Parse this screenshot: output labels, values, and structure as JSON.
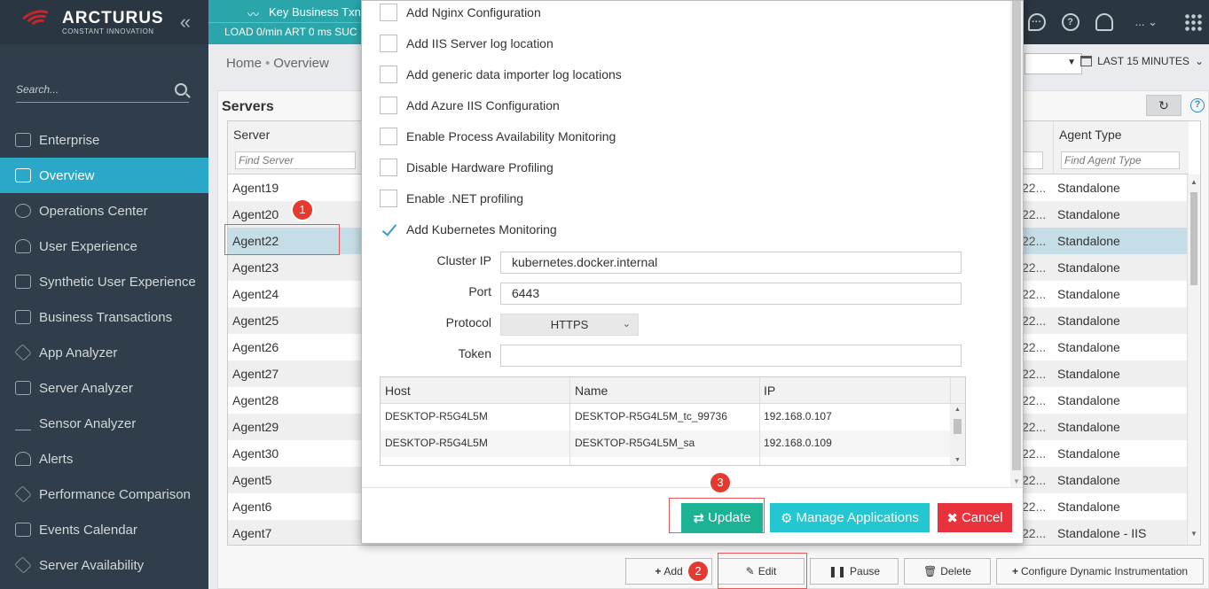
{
  "brand": {
    "name": "ARCTURUS",
    "tagline": "CONSTANT INNOVATION"
  },
  "sidebar": {
    "search_placeholder": "Search...",
    "items": [
      {
        "label": "Enterprise",
        "icon": "house-icon"
      },
      {
        "label": "Overview",
        "icon": "overview-icon",
        "active": true
      },
      {
        "label": "Operations Center",
        "icon": "globe-icon"
      },
      {
        "label": "User Experience",
        "icon": "user-icon"
      },
      {
        "label": "Synthetic User Experience",
        "icon": "map-icon"
      },
      {
        "label": "Business Transactions",
        "icon": "folder-icon"
      },
      {
        "label": "App Analyzer",
        "icon": "layers-icon"
      },
      {
        "label": "Server Analyzer",
        "icon": "bar-chart-icon"
      },
      {
        "label": "Sensor Analyzer",
        "icon": "line-chart-icon"
      },
      {
        "label": "Alerts",
        "icon": "bell-icon"
      },
      {
        "label": "Performance Comparison",
        "icon": "rocket-icon"
      },
      {
        "label": "Events Calendar",
        "icon": "calendar-icon"
      },
      {
        "label": "Server Availability",
        "icon": "tag-icon"
      }
    ]
  },
  "topbar": {
    "ktx_title": "Key Business Txn",
    "ktx_metrics": "LOAD 0/min  ART 0 ms  SUC",
    "more": "...",
    "accent": "#2aa5a9"
  },
  "breadcrumb": {
    "home": "Home",
    "current": "Overview"
  },
  "timerange": "LAST 15 MINUTES",
  "servers": {
    "title": "Servers",
    "col_server": "Server",
    "col_agent_type": "Agent Type",
    "filter_server": "Find Server",
    "filter_agent_type": "Find Agent Type",
    "rows": [
      {
        "name": "Agent19",
        "mid": "22...",
        "type": "Standalone"
      },
      {
        "name": "Agent20",
        "mid": "22...",
        "type": "Standalone"
      },
      {
        "name": "Agent22",
        "mid": "22...",
        "type": "Standalone",
        "selected": true
      },
      {
        "name": "Agent23",
        "mid": "22...",
        "type": "Standalone"
      },
      {
        "name": "Agent24",
        "mid": "22...",
        "type": "Standalone"
      },
      {
        "name": "Agent25",
        "mid": "22...",
        "type": "Standalone"
      },
      {
        "name": "Agent26",
        "mid": "22...",
        "type": "Standalone"
      },
      {
        "name": "Agent27",
        "mid": "22...",
        "type": "Standalone"
      },
      {
        "name": "Agent28",
        "mid": "22...",
        "type": "Standalone"
      },
      {
        "name": "Agent29",
        "mid": "22...",
        "type": "Standalone"
      },
      {
        "name": "Agent30",
        "mid": "22...",
        "type": "Standalone"
      },
      {
        "name": "Agent5",
        "mid": "22...",
        "type": "Standalone"
      },
      {
        "name": "Agent6",
        "mid": "22...",
        "type": "Standalone"
      },
      {
        "name": "Agent7",
        "mid": "22...",
        "type": "Standalone - IIS"
      }
    ]
  },
  "bottom_buttons": {
    "add": "Add",
    "edit": "Edit",
    "pause": "Pause",
    "delete": "Delete",
    "configure": "Configure Dynamic Instrumentation"
  },
  "modal": {
    "checkboxes": [
      {
        "label": "Add Nginx Configuration",
        "checked": false
      },
      {
        "label": "Add IIS Server log location",
        "checked": false
      },
      {
        "label": "Add generic data importer log locations",
        "checked": false
      },
      {
        "label": "Add Azure IIS Configuration",
        "checked": false
      },
      {
        "label": "Enable Process Availability Monitoring",
        "checked": false
      },
      {
        "label": "Disable Hardware Profiling",
        "checked": false
      },
      {
        "label": "Enable .NET profiling",
        "checked": false
      },
      {
        "label": "Add Kubernetes Monitoring",
        "checked": true
      }
    ],
    "fields": {
      "cluster_ip_label": "Cluster IP",
      "cluster_ip_value": "kubernetes.docker.internal",
      "port_label": "Port",
      "port_value": "6443",
      "protocol_label": "Protocol",
      "protocol_value": "HTTPS",
      "token_label": "Token",
      "token_value": ""
    },
    "hosts": {
      "col_host": "Host",
      "col_name": "Name",
      "col_ip": "IP",
      "rows": [
        {
          "host": "DESKTOP-R5G4L5M",
          "name": "DESKTOP-R5G4L5M_tc_99736",
          "ip": "192.168.0.107"
        },
        {
          "host": "DESKTOP-R5G4L5M",
          "name": "DESKTOP-R5G4L5M_sa",
          "ip": "192.168.0.109"
        }
      ]
    },
    "buttons": {
      "update": "Update",
      "manage": "Manage Applications",
      "cancel": "Cancel"
    }
  },
  "annotations": {
    "badge1": "1",
    "badge2": "2",
    "badge3": "3"
  }
}
